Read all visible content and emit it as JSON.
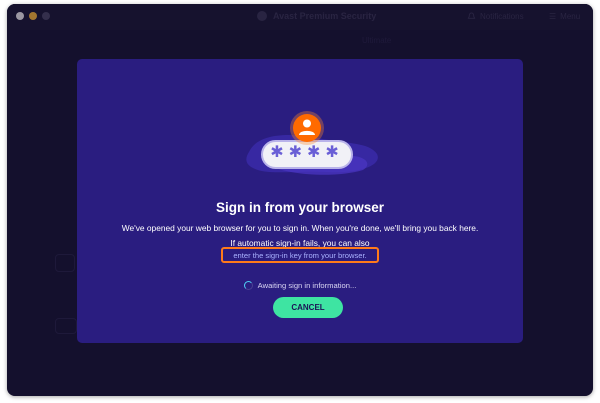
{
  "window": {
    "title": "Avast Premium Security",
    "notifications_label": "Notifications",
    "menu_label": "Menu"
  },
  "background": {
    "visible_fragment": "Ultimate"
  },
  "dialog": {
    "heading": "Sign in from your browser",
    "line1": "We've opened your web browser for you to sign in. When you're done, we'll bring you back here.",
    "line2": "If automatic sign-in fails, you can also",
    "link": "enter the sign-in key from your browser.",
    "status": "Awaiting sign in information...",
    "cancel_label": "CANCEL",
    "password_mask": "✱✱✱✱"
  },
  "colors": {
    "dialog_bg": "#2a1d80",
    "accent_orange": "#ff6a00",
    "cancel_green": "#3ee4a2",
    "link_blue": "#aab2ff",
    "highlight_orange": "#ff7a1a"
  }
}
